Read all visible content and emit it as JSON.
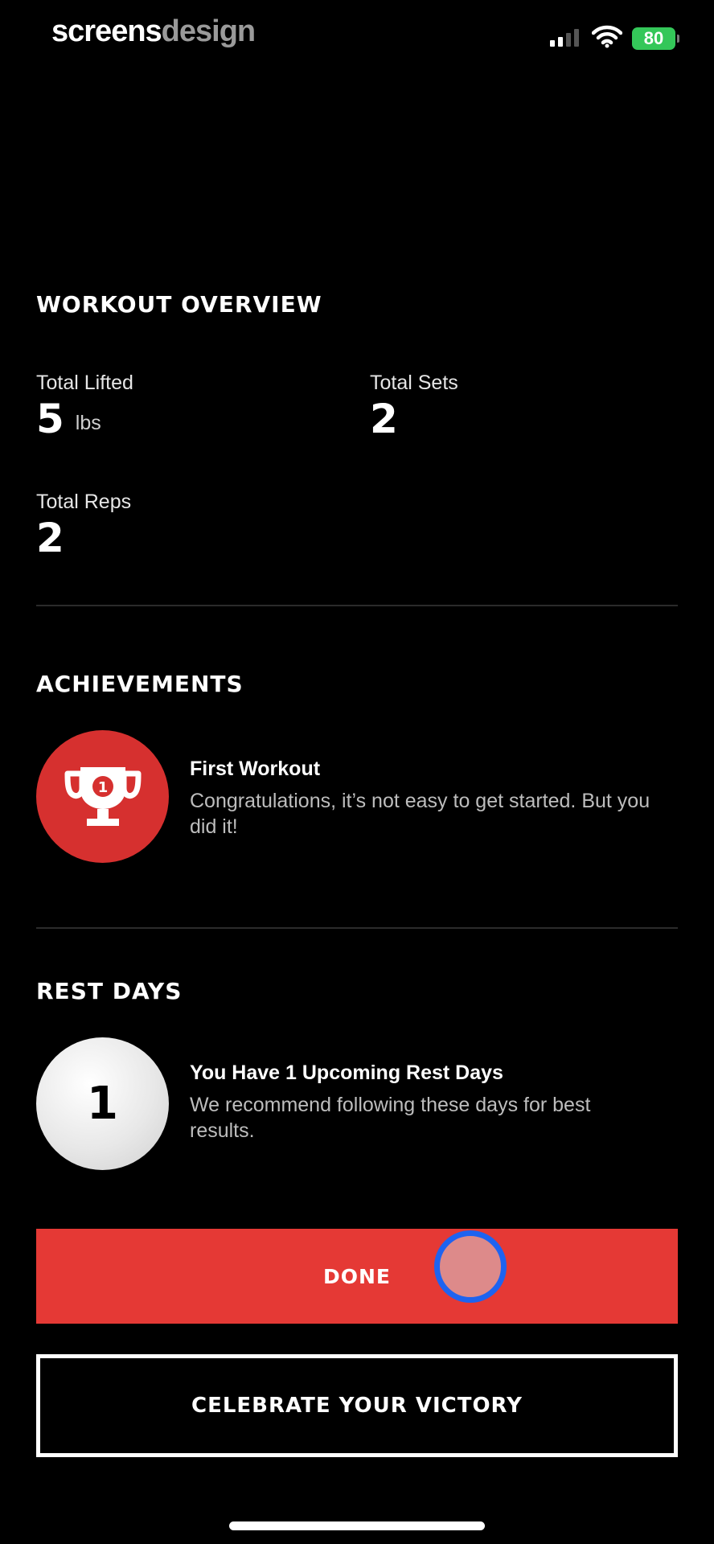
{
  "status_bar": {
    "brand_part1": "screens",
    "brand_part2": "design",
    "battery": "80"
  },
  "overview": {
    "title": "WORKOUT OVERVIEW",
    "total_lifted_label": "Total Lifted",
    "total_lifted_value": "5",
    "total_lifted_unit": "lbs",
    "total_sets_label": "Total Sets",
    "total_sets_value": "2",
    "total_reps_label": "Total Reps",
    "total_reps_value": "2"
  },
  "achievements": {
    "title": "ACHIEVEMENTS",
    "icon": "trophy-icon",
    "item_title": "First Workout",
    "item_desc": "Congratulations, it’s not easy to get started. But you did it!"
  },
  "rest_days": {
    "title": "REST DAYS",
    "badge_number": "1",
    "item_title": "You Have 1 Upcoming Rest Days",
    "item_desc": "We recommend following these days for best results."
  },
  "actions": {
    "done_label": "DONE",
    "celebrate_label": "CELEBRATE YOUR VICTORY"
  },
  "colors": {
    "accent_red": "#e53935",
    "badge_red": "#d6302f",
    "battery_green": "#34c759",
    "tap_indicator": "#1e63f0"
  }
}
